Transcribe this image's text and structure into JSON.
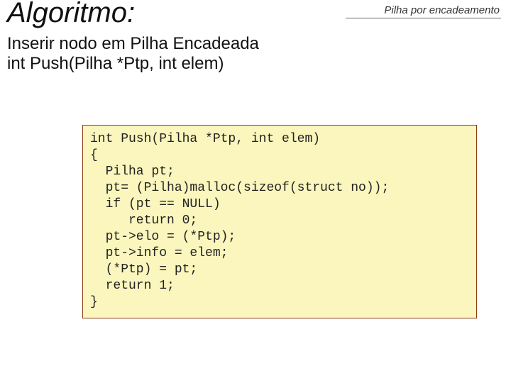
{
  "header": {
    "chapter": "Pilha por encadeamento",
    "title": "Algoritmo:",
    "subtitle_line1": "Inserir nodo em Pilha Encadeada",
    "subtitle_line2": "int Push(Pilha *Ptp, int elem)"
  },
  "code": "int Push(Pilha *Ptp, int elem)\n{\n  Pilha pt;\n  pt= (Pilha)malloc(sizeof(struct no));\n  if (pt == NULL)\n     return 0;\n  pt->elo = (*Ptp);\n  pt->info = elem;\n  (*Ptp) = pt;\n  return 1;\n}"
}
